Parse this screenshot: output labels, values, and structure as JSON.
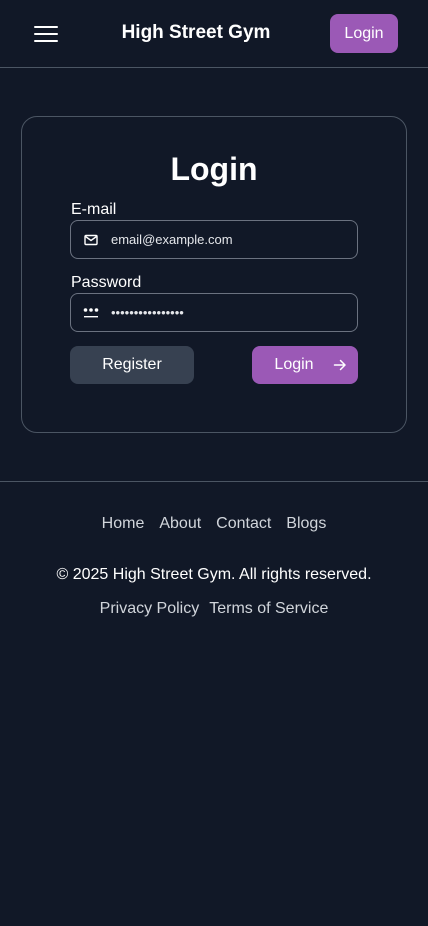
{
  "header": {
    "menu_icon": "hamburger-menu-icon",
    "title": "High Street Gym",
    "login_label": "Login"
  },
  "login_form": {
    "title": "Login",
    "email": {
      "label": "E-mail",
      "placeholder": "email@example.com",
      "icon": "mail-icon"
    },
    "password": {
      "label": "Password",
      "value": "••••••••••••••••",
      "icon": "password-dots-icon"
    },
    "register_label": "Register",
    "login_label": "Login",
    "login_icon": "arrow-right-icon"
  },
  "footer": {
    "links": [
      "Home",
      "About",
      "Contact",
      "Blogs"
    ],
    "copyright": "© 2025 High Street Gym. All rights reserved.",
    "legal": [
      "Privacy Policy",
      "Terms of Service"
    ]
  },
  "colors": {
    "background": "#111827",
    "accent": "#9b59b6",
    "secondary_button": "#374151",
    "border": "#4b5563"
  }
}
